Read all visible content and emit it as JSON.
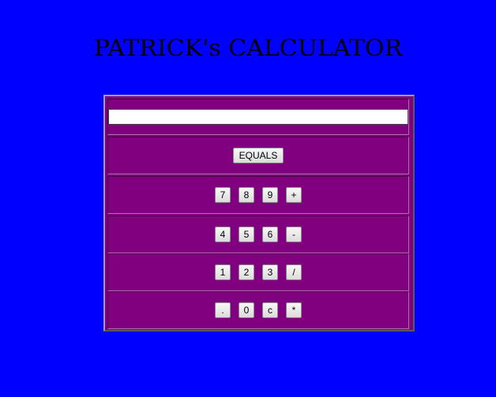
{
  "app": {
    "title": "PATRICK's CALCULATOR"
  },
  "display": {
    "value": "",
    "placeholder": ""
  },
  "equals_label": "EQUALS",
  "rows": [
    [
      "7",
      "8",
      "9",
      "+"
    ],
    [
      "4",
      "5",
      "6",
      "-"
    ],
    [
      "1",
      "2",
      "3",
      "/"
    ],
    [
      ".",
      "0",
      "c",
      "*"
    ]
  ],
  "colors": {
    "background": "#0000ff",
    "calculator": "#800080"
  }
}
